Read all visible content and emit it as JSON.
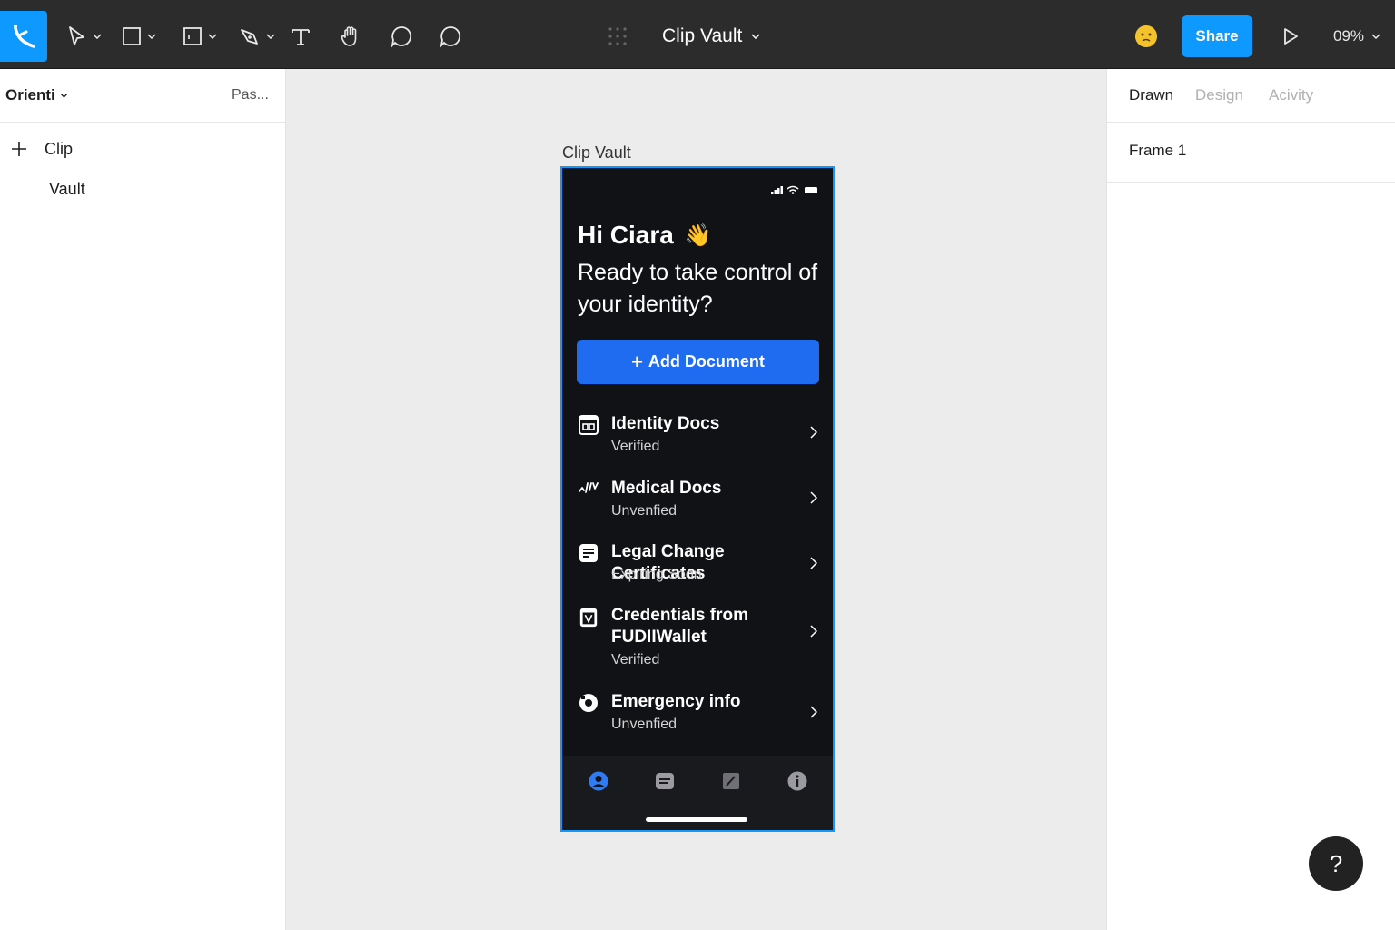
{
  "toolbar": {
    "tools": [
      {
        "name": "move-tool",
        "icon": "move-cursor-icon"
      },
      {
        "name": "frame-tool",
        "icon": "rectangle-icon"
      },
      {
        "name": "section-tool",
        "icon": "section-icon"
      },
      {
        "name": "pen-tool",
        "icon": "pen-icon"
      },
      {
        "name": "text-tool",
        "icon": "text-icon"
      },
      {
        "name": "hand-tool",
        "icon": "hand-icon"
      },
      {
        "name": "comment-tool",
        "icon": "comment-icon"
      }
    ],
    "file_title": "Clip Vault",
    "share_label": "Share",
    "zoom": "09%",
    "accent_color": "#0d99ff"
  },
  "left_panel": {
    "page_name": "Orienti",
    "pages_tab": "Pas...",
    "layers": [
      "Clip",
      "Vault"
    ]
  },
  "canvas": {
    "frame_label": "Clip Vault",
    "app": {
      "greeting": "Hi Ciara",
      "wave_emoji": "👋",
      "subhead": "Ready to take control of your identity?",
      "add_button": {
        "icon": "+",
        "label": "Add Document"
      },
      "documents": [
        {
          "title": "Identity Docs",
          "status": "Verified",
          "icon": "id-card-icon"
        },
        {
          "title": "Medical Docs",
          "status": "Unvenfied",
          "icon": "pulse-icon"
        },
        {
          "title": "Legal Change Certificates",
          "status": "Expiring Soon",
          "icon": "document-icon"
        },
        {
          "title": "Credentials from FUDIIWallet",
          "status": "Verified",
          "icon": "wallet-credential-icon"
        },
        {
          "title": "Emergency info",
          "status": "Unvenfied",
          "icon": "emergency-icon"
        }
      ],
      "tab_bar": [
        {
          "name": "profile-tab",
          "icon": "person-icon",
          "active": true
        },
        {
          "name": "documents-tab",
          "icon": "card-icon",
          "active": false
        },
        {
          "name": "edit-tab",
          "icon": "pencil-icon",
          "active": false
        },
        {
          "name": "info-tab",
          "icon": "info-icon",
          "active": false
        }
      ],
      "button_color": "#1f6cf0",
      "background_color": "#111215"
    }
  },
  "right_panel": {
    "tabs": [
      "Drawn",
      "Design",
      "Acivity"
    ],
    "active_tab": "Drawn",
    "selection": "Frame 1"
  },
  "help_label": "?"
}
